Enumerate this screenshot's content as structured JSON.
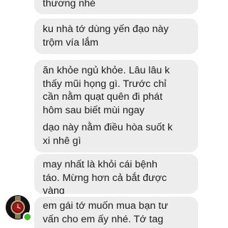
{
  "messages": [
    {
      "text": "thương nhé"
    },
    {
      "text": "ku nhà tớ dùng yến đạo này\ntrộm vía lắm"
    },
    {
      "text": "ăn khỏe ngủ khỏe. Lâu lâu k\nthấy mũi họng gì. Trước chỉ\ncần nằm quạt quên đi phát\nhôm sau biết mùi ngay"
    },
    {
      "text": "dạo này nằm điều hòa suốt k\nxi nhê gì"
    },
    {
      "text": "may nhất là khỏi cái bệnh\ntáo. Mừng hơn cả bắt được\nvàng"
    },
    {
      "text": "em gái tớ muốn mua bạn tư\nvấn cho em ấy nhé. Tớ tag"
    }
  ],
  "sender": {
    "avatar_icon": "watch-avatar-icon",
    "online": true,
    "online_color": "#42b72a"
  },
  "colors": {
    "bubble": "#ededee",
    "text": "#1c1c1c"
  }
}
